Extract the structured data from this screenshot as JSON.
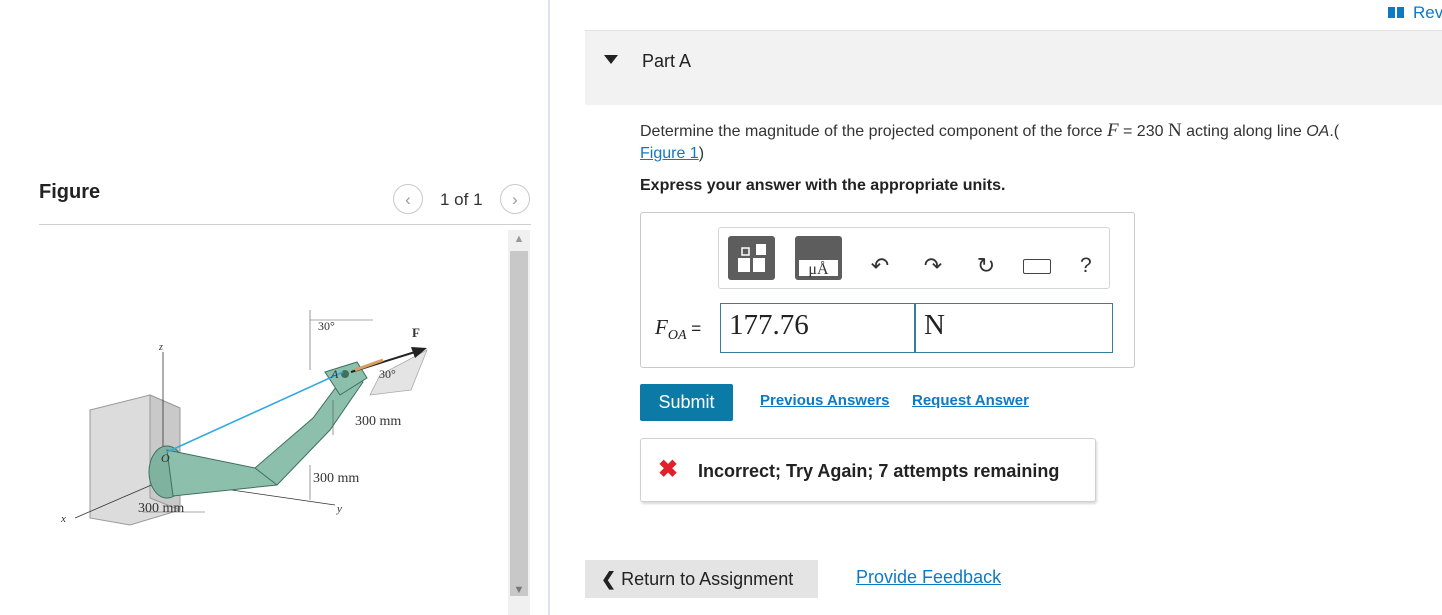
{
  "figure": {
    "title": "Figure",
    "counter": "1 of 1",
    "prev_icon": "chevron-left-icon",
    "next_icon": "chevron-right-icon",
    "labels": {
      "angle_top": "30°",
      "angle_side": "30°",
      "force": "F",
      "dim_vertical": "300 mm",
      "dim_middle": "300 mm",
      "dim_base": "300 mm",
      "axis_z": "z",
      "axis_x": "x",
      "axis_y": "y",
      "point_a": "A",
      "point_o": "O"
    }
  },
  "header": {
    "review_label": "Rev",
    "review_icon": "book-icon"
  },
  "part": {
    "title": "Part A",
    "question_pre": "Determine the magnitude of the projected component of the force ",
    "force_symbol": "F",
    "force_value": " = 230 ",
    "force_unit": "N",
    "question_post": " acting along line ",
    "line_name": "OA",
    "figure_link_open": ".(",
    "figure_link": "Figure 1",
    "figure_link_close": ")",
    "instruction": "Express your answer with the appropriate units."
  },
  "answer": {
    "variable": "F",
    "variable_sub": "OA",
    "equals": " =",
    "value": "177.76",
    "unit": "N",
    "toolbar": {
      "templates_icon": "templates-icon",
      "units_icon": "units-icon",
      "units_label": "μÅ",
      "undo_icon": "undo-icon",
      "redo_icon": "redo-icon",
      "reset_icon": "reset-icon",
      "keyboard_icon": "keyboard-icon",
      "help_label": "?"
    }
  },
  "actions": {
    "submit": "Submit",
    "previous_answers": "Previous Answers",
    "request_answer": "Request Answer"
  },
  "feedback": {
    "icon": "x-icon",
    "message": "Incorrect; Try Again; 7 attempts remaining"
  },
  "footer": {
    "return_label": "Return to Assignment",
    "provide_feedback": "Provide Feedback"
  },
  "colors": {
    "accent": "#0c7aa6",
    "link": "#0e7ac4",
    "error": "#e0202a",
    "rod": "#7fb3a0",
    "line_oa": "#33a9e0"
  }
}
